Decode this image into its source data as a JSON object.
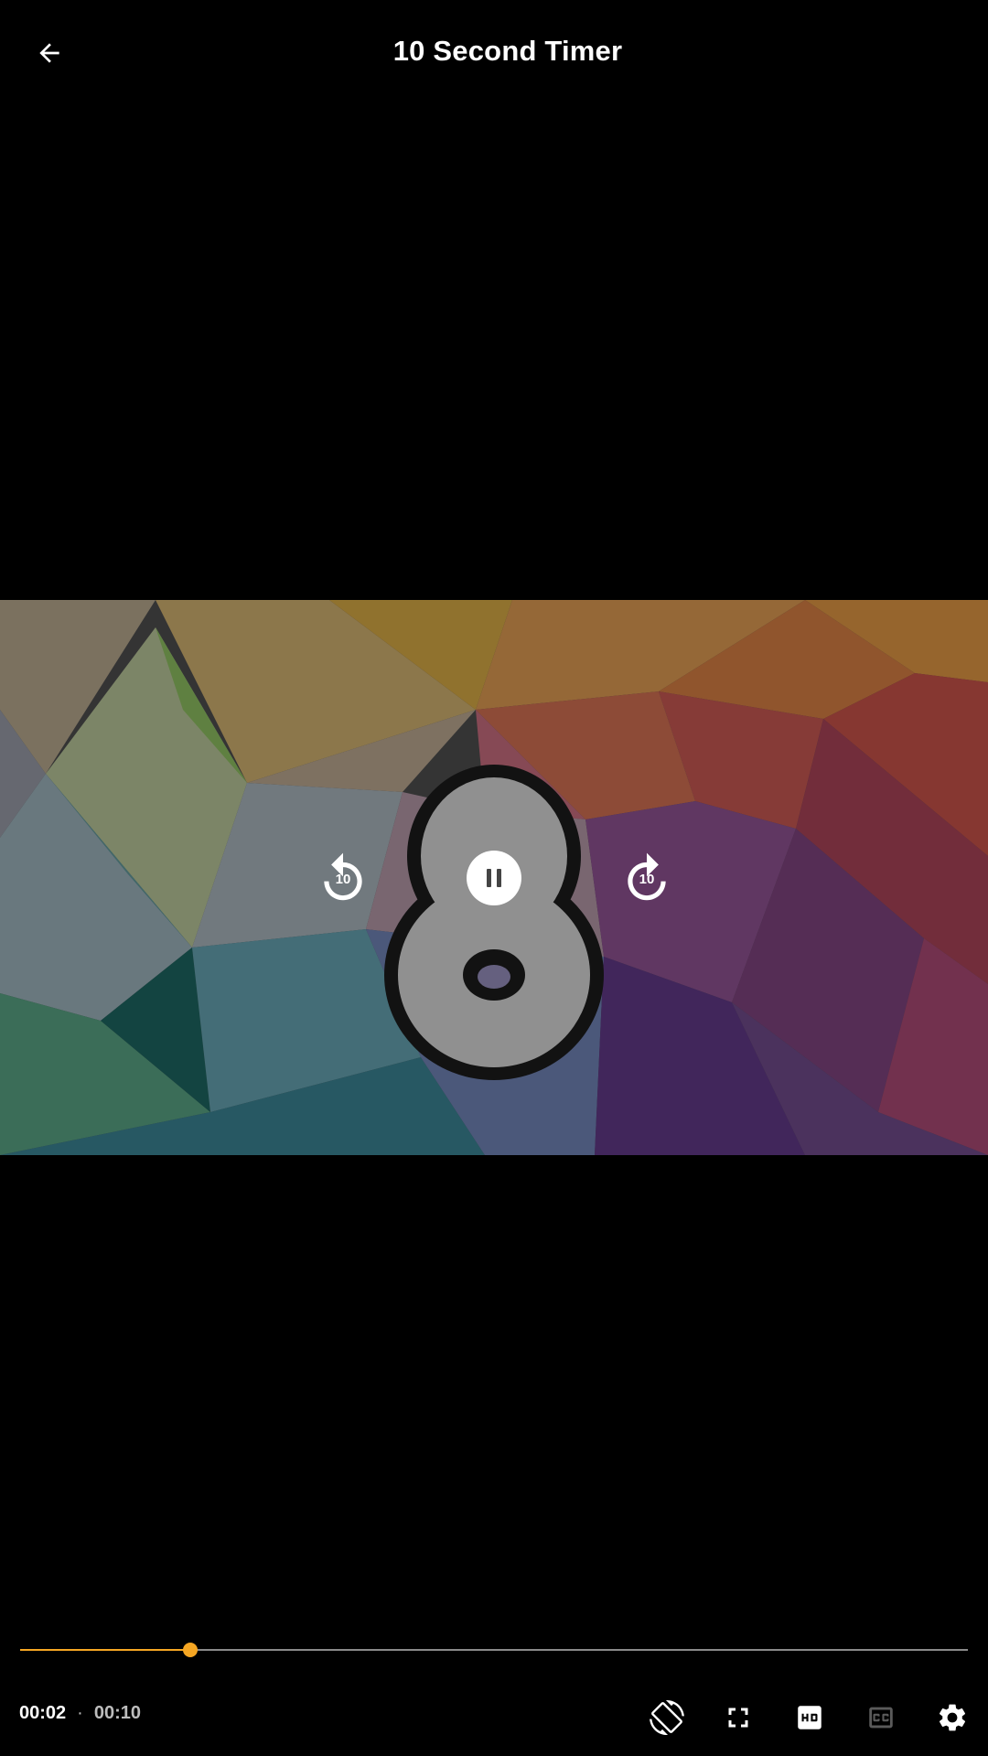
{
  "header": {
    "title": "10 Second Timer",
    "back_icon": "arrow-back-icon"
  },
  "player": {
    "rewind_seconds": "10",
    "forward_seconds": "10",
    "state": "playing",
    "current_time": "00:02",
    "separator": "·",
    "duration": "00:10",
    "progress": 0.18,
    "accent_color": "#f5a623"
  },
  "controls": {
    "icons": [
      "screen-rotation-icon",
      "fullscreen-icon",
      "hd-icon",
      "closed-captions-icon",
      "settings-icon"
    ]
  }
}
